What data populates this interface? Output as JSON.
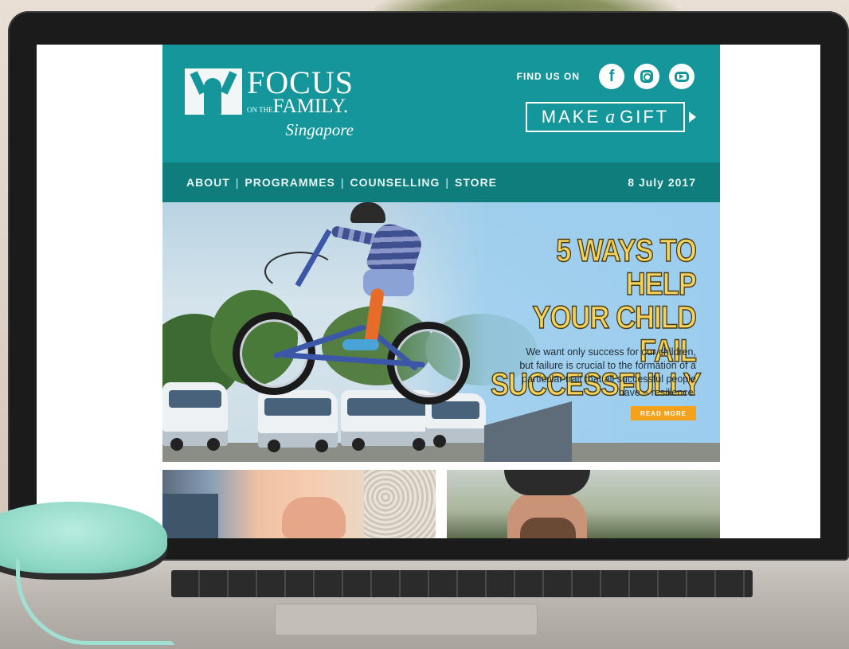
{
  "header": {
    "logo": {
      "line1": "FOCUS",
      "line2_small": "ON THE",
      "line2": "FAMILY.",
      "line3": "Singapore"
    },
    "find_us_label": "FIND US ON",
    "social": [
      {
        "name": "facebook-icon",
        "glyph": "f"
      },
      {
        "name": "instagram-icon"
      },
      {
        "name": "youtube-icon"
      }
    ],
    "gift": {
      "word1": "MAKE",
      "word2": "a",
      "word3": "GIFT"
    }
  },
  "nav": {
    "items": [
      "ABOUT",
      "PROGRAMMES",
      "COUNSELLING",
      "STORE"
    ],
    "separator": "|",
    "date": "8 July 2017"
  },
  "hero": {
    "headline_line1": "5 WAYS TO HELP",
    "headline_line2": "YOUR CHILD FAIL",
    "headline_line3": "SUCCESSFULLY",
    "blurb": "We want only success for our children, but failure is crucial to the formation of a particular trait that all successful people have – resilience.",
    "read_more": "READ MORE"
  },
  "colors": {
    "header_teal": "#14969b",
    "nav_teal": "#0f7d7c",
    "headline_yellow": "#f3d35c",
    "button_orange": "#f4a21b"
  }
}
